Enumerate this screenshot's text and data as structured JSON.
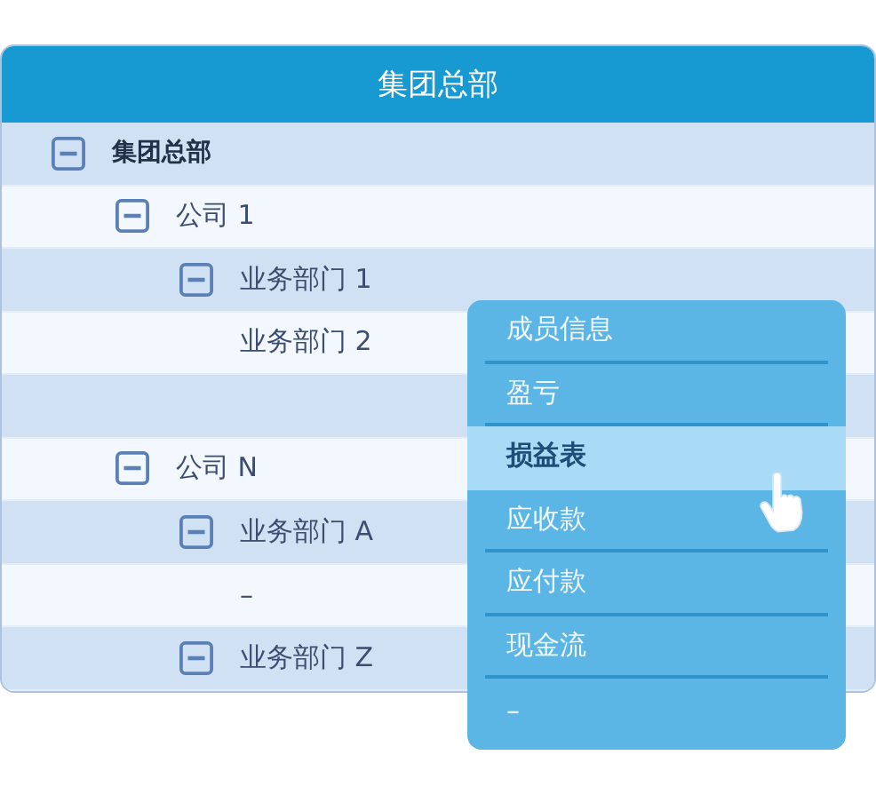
{
  "header": {
    "title": "集团总部"
  },
  "tree": [
    {
      "kind": "node",
      "label": "集团总部",
      "expanded": true,
      "children": [
        {
          "kind": "node",
          "label": "公司 1",
          "expanded": true,
          "children": [
            {
              "kind": "node",
              "label": "业务部门 1",
              "expanded": true
            },
            {
              "kind": "leaf",
              "label": "业务部门 2"
            }
          ]
        },
        {
          "kind": "blank"
        },
        {
          "kind": "node",
          "label": "公司 N",
          "expanded": true,
          "children": [
            {
              "kind": "node",
              "label": "业务部门 A",
              "expanded": true
            },
            {
              "kind": "leaf",
              "label": "–"
            },
            {
              "kind": "node",
              "label": "业务部门 Z",
              "expanded": true
            }
          ]
        }
      ]
    }
  ],
  "menu": [
    {
      "label": "成员信息",
      "selected": false
    },
    {
      "label": "盈亏",
      "selected": false
    },
    {
      "label": "损益表",
      "selected": true
    },
    {
      "label": "应收款",
      "selected": false
    },
    {
      "label": "应付款",
      "selected": false
    },
    {
      "label": "现金流",
      "selected": false
    },
    {
      "label": "–",
      "selected": false
    }
  ]
}
